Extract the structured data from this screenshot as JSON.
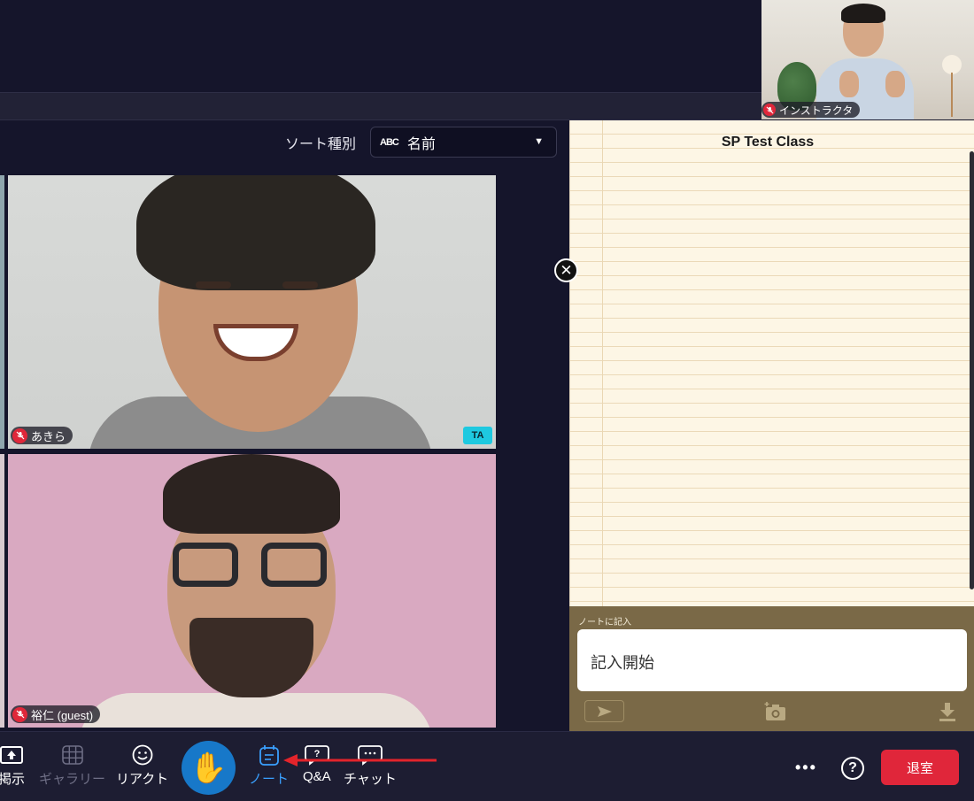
{
  "instructor": {
    "name": "インストラクタ"
  },
  "sort": {
    "label": "ソート種別",
    "selected": "名前",
    "type_icon_text": "ABC"
  },
  "participants": [
    {
      "name": "あきら",
      "mic": "muted",
      "badge": "TA"
    },
    {
      "name": "裕仁 (guest)",
      "mic": "muted",
      "badge": ""
    }
  ],
  "notes": {
    "title": "SP Test Class",
    "input_label": "ノートに記入",
    "input_placeholder": "記入開始"
  },
  "toolbar": {
    "items": [
      {
        "label": "掲示",
        "icon": "upload-board-icon",
        "state": "normal"
      },
      {
        "label": "ギャラリー",
        "icon": "grid-icon",
        "state": "disabled"
      },
      {
        "label": "リアクト",
        "icon": "smiley-icon",
        "state": "normal"
      },
      {
        "label": "ノート",
        "icon": "note-icon",
        "state": "active"
      },
      {
        "label": "Q&A",
        "icon": "question-bubble-icon",
        "state": "normal"
      },
      {
        "label": "チャット",
        "icon": "chat-bubble-icon",
        "state": "normal"
      }
    ],
    "hand_icon": "✋",
    "more_label": "•••",
    "help_label": "?",
    "leave_label": "退室"
  },
  "colors": {
    "background": "#15152b",
    "toolbar": "#1d1d32",
    "accent_blue": "#3aa0ff",
    "hand_button": "#1778c9",
    "leave_red": "#e0263a",
    "ta_badge": "#1ec9e0",
    "notes_paper": "#fdf6e5",
    "notes_input_panel": "#7a6947",
    "annotation_arrow": "#e3242b"
  }
}
